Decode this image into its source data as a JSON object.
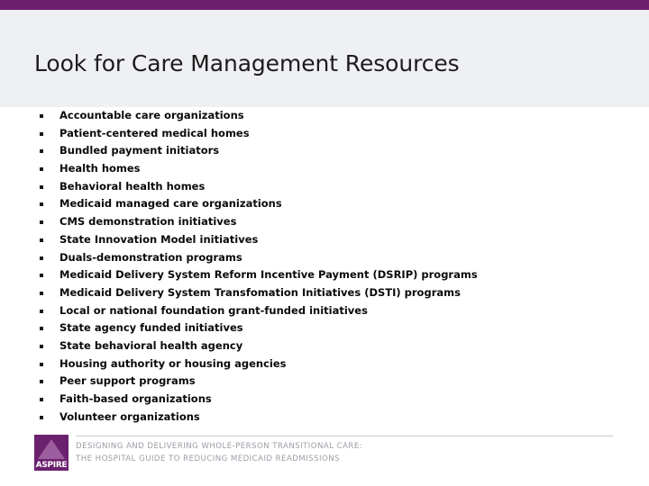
{
  "slide": {
    "title": "Look for Care Management Resources",
    "accent_color": "#6B216E",
    "header_background": "#EFF0F4",
    "body_background": "#FFFFFF"
  },
  "bullets": [
    {
      "label": "Accountable care organizations"
    },
    {
      "label": "Patient-centered medical homes"
    },
    {
      "label": "Bundled payment initiators"
    },
    {
      "label": "Health homes"
    },
    {
      "label": "Behavioral health homes"
    },
    {
      "label": "Medicaid managed care organizations"
    },
    {
      "label": "CMS demonstration initiatives"
    },
    {
      "label": "State Innovation Model initiatives"
    },
    {
      "label": "Duals-demonstration programs"
    },
    {
      "label": "Medicaid Delivery System Reform Incentive Payment (DSRIP) programs"
    },
    {
      "label": "Medicaid Delivery System Transfomation Initiatives (DSTI) programs"
    },
    {
      "label": "Local or national foundation grant-funded initiatives"
    },
    {
      "label": "State agency funded initiatives"
    },
    {
      "label": "State behavioral health agency"
    },
    {
      "label": "Housing authority or housing agencies"
    },
    {
      "label": "Peer support programs"
    },
    {
      "label": "Faith-based organizations"
    },
    {
      "label": "Volunteer organizations"
    }
  ],
  "footer": {
    "logo_text": "ASPIRE",
    "logo_color": "#6B216E",
    "tagline_line1": "DESIGNING AND DELIVERING WHOLE-PERSON TRANSITIONAL CARE:",
    "tagline_line2": "THE HOSPITAL GUIDE TO REDUCING MEDICAID READMISSIONS",
    "tagline_color": "#9C9CA6"
  }
}
